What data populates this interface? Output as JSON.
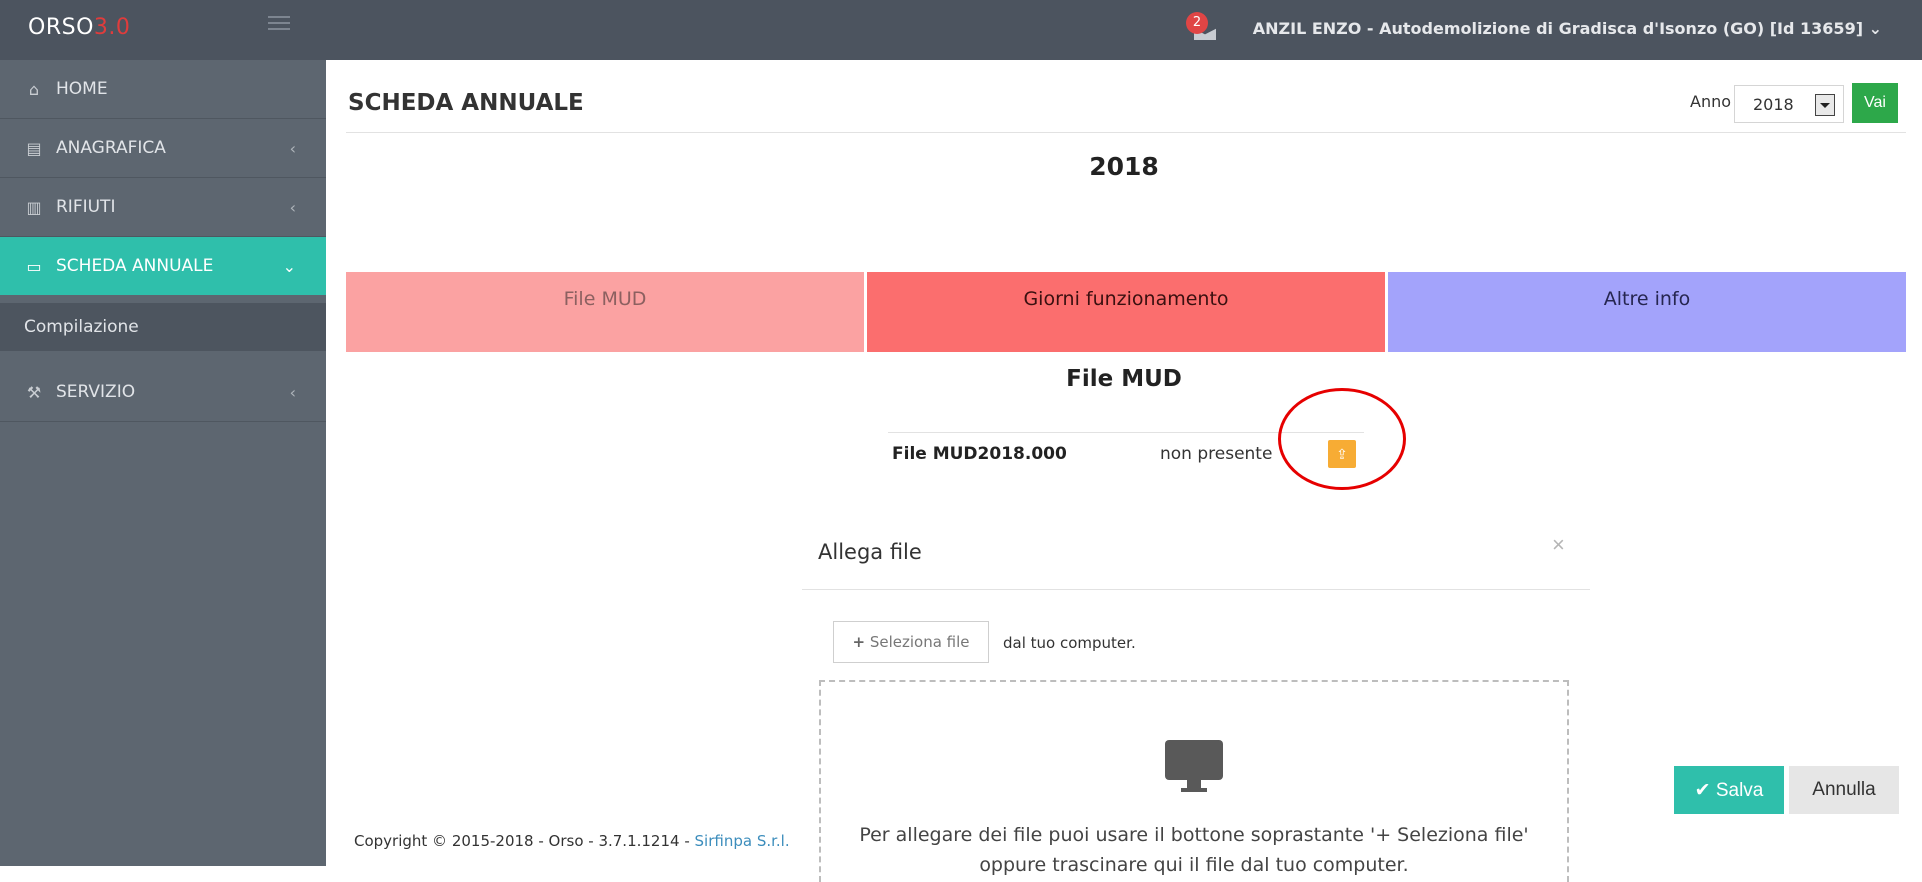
{
  "header": {
    "logo_main": "ORSO",
    "logo_version": "3.0",
    "notifications_count": "2",
    "user_label": "ANZIL ENZO - Autodemolizione di Gradisca d'Isonzo (GO) [Id 13659]",
    "user_chevron": "⌄"
  },
  "sidebar": {
    "items": [
      {
        "label": "HOME",
        "icon": "home-icon",
        "glyph": "⌂",
        "chevron": ""
      },
      {
        "label": "ANAGRAFICA",
        "icon": "document-icon",
        "glyph": "▤",
        "chevron": "‹"
      },
      {
        "label": "RIFIUTI",
        "icon": "trash-icon",
        "glyph": "▥",
        "chevron": "‹"
      },
      {
        "label": "SCHEDA ANNUALE",
        "icon": "calendar-icon",
        "glyph": "▭",
        "chevron": "⌄"
      },
      {
        "label": "SERVIZIO",
        "icon": "wrench-icon",
        "glyph": "⚒",
        "chevron": "‹"
      }
    ],
    "sub_item": "Compilazione"
  },
  "main": {
    "title": "SCHEDA ANNUALE",
    "anno_label": "Anno",
    "anno_value": "2018",
    "vai_label": "Vai",
    "year_heading": "2018",
    "tabs": [
      "File MUD",
      "Giorni funzionamento",
      "Altre info"
    ],
    "section_title": "File MUD",
    "file_label": "File MUD2018.000",
    "file_status": "non presente",
    "upload_glyph": "⇪"
  },
  "modal": {
    "title": "Allega file",
    "close": "×",
    "select_plus": "+",
    "select_label": "Seleziona file",
    "select_suffix": "dal tuo computer.",
    "drop_line1": "Per allegare dei file puoi usare il bottone soprastante '+ Seleziona file'",
    "drop_line2": "oppure trascinare qui il file dal tuo computer.",
    "salva_label": "Salva",
    "salva_check": "✔",
    "annulla_label": "Annulla"
  },
  "footer": {
    "text": "Copyright © 2015-2018 - Orso - 3.7.1.1214 -",
    "link": "Sirfinpa S.r.l."
  },
  "colors": {
    "accent": "#2fbfab",
    "sidebar": "#5d6670",
    "topbar": "#4c545f",
    "tab_file_mud": "#fba2a2",
    "tab_giorni": "#fb6e6e",
    "tab_altre": "#a3a3fb",
    "vai": "#2da84a",
    "upload": "#f7ac34",
    "annotation_circle": "#e60000"
  }
}
